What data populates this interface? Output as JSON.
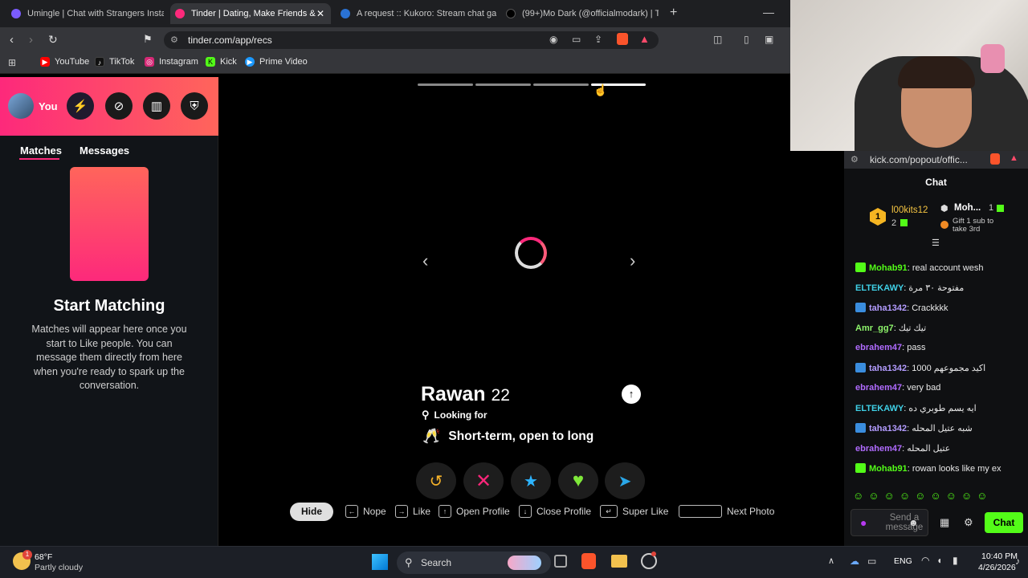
{
  "browser": {
    "tabs": [
      {
        "label": "Umingle | Chat with Strangers Instant",
        "color": "#7b5cff"
      },
      {
        "label": "Tinder | Dating, Make Friends &",
        "color": "#fd297b"
      },
      {
        "label": "A request :: Kukoro: Stream chat gam",
        "color": "#2a72d4"
      },
      {
        "label": "(99+)Mo Dark (@officialmodark) | Ti",
        "color": "#111111"
      }
    ],
    "url": "tinder.com/app/recs",
    "bookmarks": [
      {
        "label": "YouTube",
        "color": "#ff0000",
        "glyph": "▶"
      },
      {
        "label": "TikTok",
        "color": "#111111",
        "glyph": "♪"
      },
      {
        "label": "Instagram",
        "color": "#d62976",
        "glyph": "◎"
      },
      {
        "label": "Kick",
        "color": "#53fc18",
        "glyph": "K"
      },
      {
        "label": "Prime Video",
        "color": "#1a98ff",
        "glyph": "▶"
      }
    ]
  },
  "sidebar": {
    "you_label": "You",
    "tabs": [
      "Matches",
      "Messages"
    ],
    "title": "Start Matching",
    "description": "Matches will appear here once you start to Like people. You can message them directly from here when you're ready to spark up the conversation."
  },
  "profile": {
    "name": "Rawan",
    "age": "22",
    "looking_for_label": "Looking for",
    "looking_for_value": "Short-term, open to long",
    "photo_count": 4,
    "current_photo": 4
  },
  "hints": {
    "hide": "Hide",
    "nope": "Nope",
    "like": "Like",
    "open_profile": "Open Profile",
    "close_profile": "Close Profile",
    "super_like": "Super Like",
    "next_photo": "Next Photo"
  },
  "chat": {
    "url": "kick.com/popout/offic...",
    "title": "Chat",
    "leader1": {
      "name": "l00kits12",
      "rank": "1",
      "count": "2"
    },
    "leader2": {
      "name": "Moh...",
      "count": "1"
    },
    "gift_text": "Gift 1 sub to take 3rd",
    "messages": [
      {
        "user": "Mohab91",
        "color": "#53fc18",
        "badge": "#53fc18",
        "text": "real account wesh"
      },
      {
        "user": "ELTEKAWY",
        "color": "#3fd0e6",
        "badge": "",
        "text": "مفتوحة ٣٠ مرة"
      },
      {
        "user": "taha1342",
        "color": "#b39cff",
        "badge": "#3a8dde",
        "text": "Crackkkk"
      },
      {
        "user": "Amr_gg7",
        "color": "#8ef56b",
        "badge": "",
        "text": "تيك تيك"
      },
      {
        "user": "ebrahem47",
        "color": "#b06bff",
        "badge": "",
        "text": "pass"
      },
      {
        "user": "taha1342",
        "color": "#b39cff",
        "badge": "#3a8dde",
        "text": "اكيد مجموعهم 1000"
      },
      {
        "user": "ebrahem47",
        "color": "#b06bff",
        "badge": "",
        "text": "very bad"
      },
      {
        "user": "ELTEKAWY",
        "color": "#3fd0e6",
        "badge": "",
        "text": "ايه يسم طوبري ده"
      },
      {
        "user": "taha1342",
        "color": "#b39cff",
        "badge": "#3a8dde",
        "text": "شبه عتيل المحله"
      },
      {
        "user": "ebrahem47",
        "color": "#b06bff",
        "badge": "",
        "text": "عتيل المحله"
      },
      {
        "user": "Mohab91",
        "color": "#53fc18",
        "badge": "#53fc18",
        "text": "rowan looks like my ex"
      }
    ],
    "input_placeholder": "Send a message",
    "send_label": "Chat"
  },
  "taskbar": {
    "temp": "68°F",
    "weather": "Partly cloudy",
    "search": "Search",
    "lang": "ENG",
    "time": "10:40 PM",
    "date": "4/26/2026",
    "notif_count": "1"
  }
}
